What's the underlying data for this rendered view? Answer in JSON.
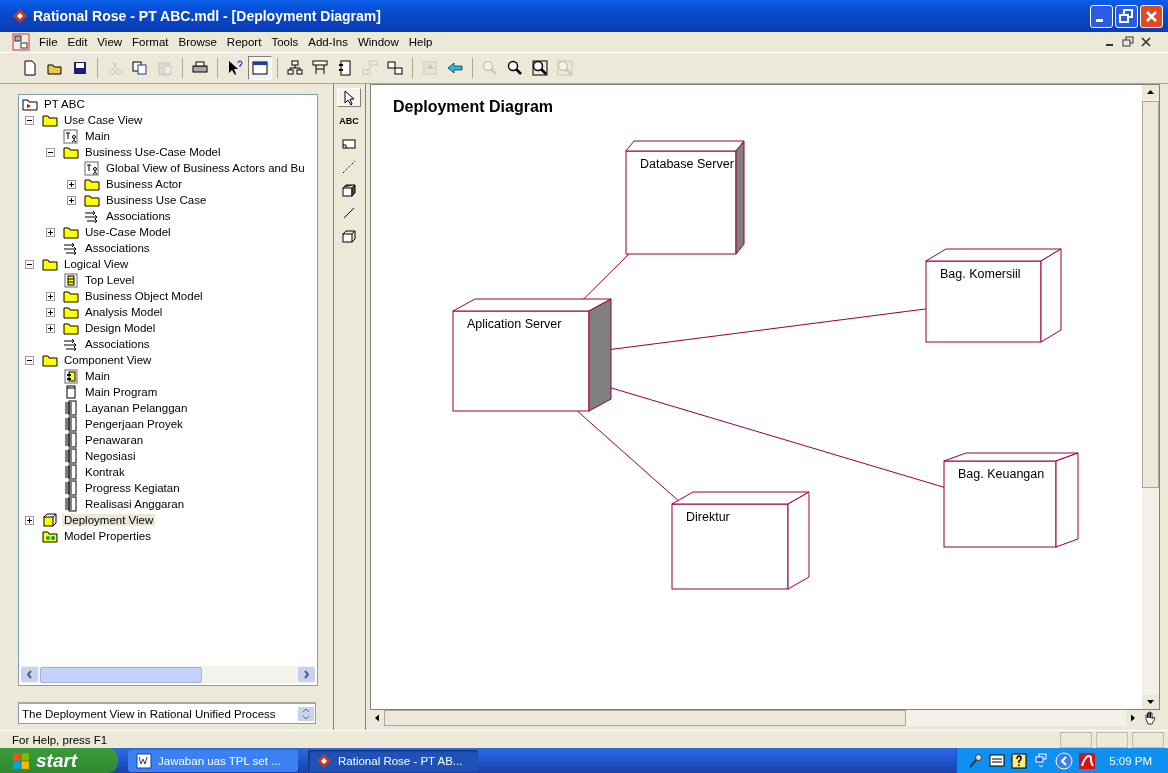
{
  "window": {
    "title": "Rational Rose - PT ABC.mdl - [Deployment Diagram]"
  },
  "menu": [
    "File",
    "Edit",
    "View",
    "Format",
    "Browse",
    "Report",
    "Tools",
    "Add-Ins",
    "Window",
    "Help"
  ],
  "toolbar": [
    {
      "disabled": false,
      "pressed": false
    },
    {
      "disabled": false,
      "pressed": false
    },
    {
      "disabled": false,
      "pressed": false
    },
    {
      "disabled": true,
      "pressed": false
    },
    {
      "disabled": false,
      "pressed": false
    },
    {
      "disabled": true,
      "pressed": false
    },
    {
      "disabled": false,
      "pressed": false
    },
    {
      "disabled": false,
      "pressed": false
    },
    {
      "disabled": false,
      "pressed": true
    },
    {
      "disabled": false,
      "pressed": false
    },
    {
      "disabled": false,
      "pressed": false
    },
    {
      "disabled": false,
      "pressed": false
    },
    {
      "disabled": true,
      "pressed": false
    },
    {
      "disabled": false,
      "pressed": false
    },
    {
      "disabled": true,
      "pressed": false
    },
    {
      "disabled": false,
      "pressed": false
    },
    {
      "disabled": true,
      "pressed": false
    },
    {
      "disabled": false,
      "pressed": false
    },
    {
      "disabled": false,
      "pressed": false
    },
    {
      "disabled": true,
      "pressed": false
    }
  ],
  "tree": {
    "items": [
      {
        "label": "PT ABC",
        "kind": "model",
        "selected": false,
        "children": [
          {
            "label": "Use Case View",
            "kind": "folder",
            "selected": false,
            "expanded": true,
            "children": [
              {
                "label": "Main",
                "kind": "usecase-diagram",
                "selected": false
              },
              {
                "label": "Business Use-Case Model",
                "kind": "folder",
                "selected": false,
                "expanded": true,
                "children": [
                  {
                    "label": "Global View of Business Actors and Bu",
                    "kind": "usecase-diagram",
                    "selected": false
                  },
                  {
                    "label": "Business Actor",
                    "kind": "folder",
                    "selected": false,
                    "expanded": false
                  },
                  {
                    "label": "Business Use Case",
                    "kind": "folder",
                    "selected": false,
                    "expanded": false
                  },
                  {
                    "label": "Associations",
                    "kind": "associations",
                    "selected": false
                  }
                ]
              },
              {
                "label": "Use-Case Model",
                "kind": "folder",
                "selected": false,
                "expanded": false
              },
              {
                "label": "Associations",
                "kind": "associations",
                "selected": false
              }
            ]
          },
          {
            "label": "Logical View",
            "kind": "folder",
            "selected": false,
            "expanded": true,
            "children": [
              {
                "label": "Top Level",
                "kind": "class-diagram",
                "selected": false
              },
              {
                "label": "Business Object Model",
                "kind": "folder",
                "selected": false,
                "expanded": false
              },
              {
                "label": "Analysis Model",
                "kind": "folder",
                "selected": false,
                "expanded": false
              },
              {
                "label": "Design Model",
                "kind": "folder",
                "selected": false,
                "expanded": false
              },
              {
                "label": "Associations",
                "kind": "associations",
                "selected": false
              }
            ]
          },
          {
            "label": "Component View",
            "kind": "folder",
            "selected": false,
            "expanded": true,
            "children": [
              {
                "label": "Main",
                "kind": "component-diagram",
                "selected": false
              },
              {
                "label": "Main Program",
                "kind": "main-program",
                "selected": false
              },
              {
                "label": "Layanan Pelanggan",
                "kind": "package-body",
                "selected": false
              },
              {
                "label": "Pengerjaan Proyek",
                "kind": "package-body",
                "selected": false
              },
              {
                "label": "Penawaran",
                "kind": "package-body",
                "selected": false
              },
              {
                "label": "Negosiasi",
                "kind": "package-body",
                "selected": false
              },
              {
                "label": "Kontrak",
                "kind": "package-body",
                "selected": false
              },
              {
                "label": "Progress Kegiatan",
                "kind": "package-body",
                "selected": false
              },
              {
                "label": "Realisasi Anggaran",
                "kind": "package-body",
                "selected": false
              }
            ]
          },
          {
            "label": "Deployment View",
            "kind": "deployment",
            "selected": true,
            "expanded": false
          },
          {
            "label": "Model Properties",
            "kind": "properties",
            "selected": false
          }
        ]
      }
    ]
  },
  "documentation": {
    "value": "The Deployment View in Rational Unified Process"
  },
  "palette": [
    {
      "kind": "pointer",
      "selected": true
    },
    {
      "kind": "text",
      "label": "ABC",
      "selected": false
    },
    {
      "kind": "note",
      "selected": false
    },
    {
      "kind": "dashed-line",
      "selected": false
    },
    {
      "kind": "processor",
      "selected": false
    },
    {
      "kind": "line",
      "selected": false
    },
    {
      "kind": "device",
      "selected": false
    }
  ],
  "diagram": {
    "title": "Deployment Diagram",
    "nodes": [
      {
        "name": "Database Server",
        "kind": "processor"
      },
      {
        "name": "Aplication Server",
        "kind": "processor"
      },
      {
        "name": "Bag. Komersiil",
        "kind": "device"
      },
      {
        "name": "Bag. Keuangan",
        "kind": "device"
      },
      {
        "name": "Direktur",
        "kind": "device"
      }
    ]
  },
  "status_bar": {
    "text": "For Help, press F1"
  },
  "taskbar": {
    "start": "start",
    "tasks": [
      {
        "label": "Jawaban uas TPL set ...",
        "selected": false
      },
      {
        "label": "Rational Rose - PT AB...",
        "selected": true
      }
    ],
    "clock": "5:09 PM"
  }
}
